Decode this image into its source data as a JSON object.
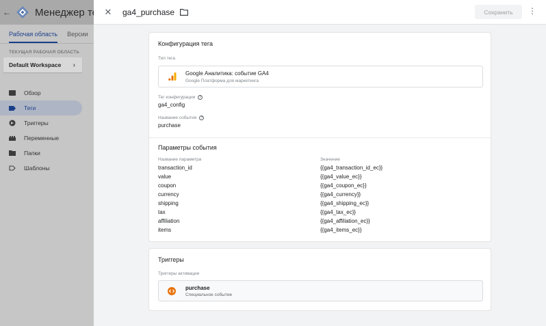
{
  "sidebar": {
    "back_icon": "arrow-left-icon",
    "title": "Менеджер тегов",
    "tabs": [
      {
        "label": "Рабочая область",
        "active": true
      },
      {
        "label": "Версии",
        "active": false
      }
    ],
    "workspace_label": "ТЕКУЩАЯ РАБОЧАЯ ОБЛАСТЬ",
    "workspace_name": "Default Workspace",
    "nav": [
      {
        "label": "Обзор",
        "icon": "overview-icon",
        "active": false
      },
      {
        "label": "Теги",
        "icon": "tag-icon",
        "active": true
      },
      {
        "label": "Триггеры",
        "icon": "trigger-icon",
        "active": false
      },
      {
        "label": "Переменные",
        "icon": "variables-icon",
        "active": false
      },
      {
        "label": "Папки",
        "icon": "folder-icon",
        "active": false
      },
      {
        "label": "Шаблоны",
        "icon": "template-icon",
        "active": false
      }
    ]
  },
  "topbar": {
    "tag_name": "ga4_purchase",
    "save_label": "Сохранить"
  },
  "config": {
    "title": "Конфигурация тега",
    "type_label": "Тип тега",
    "type_name": "Google Аналитика: событие GA4",
    "type_sub": "Google Платформа для маркетинга",
    "config_tag_label": "Тег конфигурации",
    "config_tag_value": "ga4_config",
    "event_name_label": "Название события",
    "event_name_value": "purchase",
    "params_title": "Параметры события",
    "params_col_name": "Название параметра",
    "params_col_value": "Значение",
    "params": [
      {
        "name": "transaction_id",
        "value": "{{ga4_transaction_id_ec}}"
      },
      {
        "name": "value",
        "value": "{{ga4_value_ec}}"
      },
      {
        "name": "coupon",
        "value": "{{ga4_coupon_ec}}"
      },
      {
        "name": "currency",
        "value": "{{ga4_currency}}"
      },
      {
        "name": "shipping",
        "value": "{{ga4_shipping_ec}}"
      },
      {
        "name": "tax",
        "value": "{{ga4_tax_ec}}"
      },
      {
        "name": "affiliation",
        "value": "{{ga4_affiliation_ec}}"
      },
      {
        "name": "items",
        "value": "{{ga4_items_ec}}"
      }
    ]
  },
  "triggers": {
    "title": "Триггеры",
    "firing_label": "Триггеры активации",
    "items": [
      {
        "name": "purchase",
        "type": "Специальное событие"
      }
    ]
  },
  "colors": {
    "accent": "#1a73e8",
    "ga_orange": "#f9ab00",
    "ga_dark_orange": "#e37400",
    "trigger_orange": "#e8710a"
  }
}
